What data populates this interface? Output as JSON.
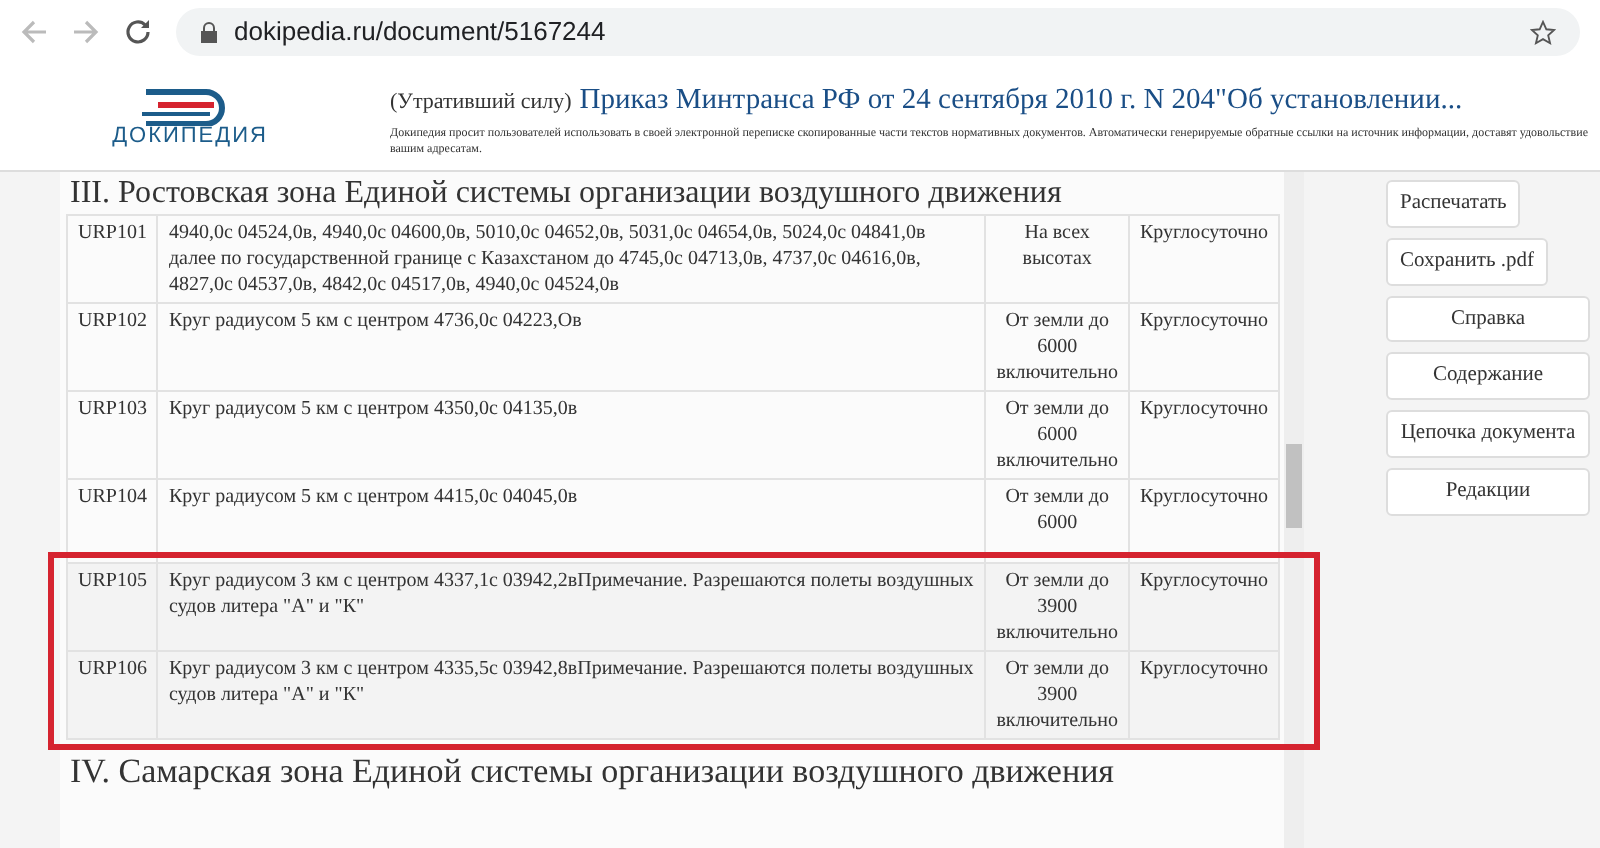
{
  "browser": {
    "url": "dokipedia.ru/document/5167244"
  },
  "header": {
    "logo": "ДОКИПЕДИЯ",
    "status": "(Утративший силу)",
    "title": "Приказ Минтранса РФ от 24 сентября 2010 г. N 204\"Об установлении...",
    "notice": "Докипедия просит пользователей использовать в своей электронной переписке скопированные части текстов нормативных документов. Автоматически генерируемые обратные ссылки на источник информации, доставят удовольствие вашим адресатам."
  },
  "section_heading": "III. Ростовская зона Единой системы организации воздушного движения",
  "row_groups": [
    {
      "highlighted": false,
      "rows": [
        {
          "code": "URP101",
          "description": "4940,0с 04524,0в, 4940,0с 04600,0в, 5010,0с 04652,0в, 5031,0с 04654,0в, 5024,0с 04841,0в далее по государственной границе с Казахстаном до 4745,0с 04713,0в, 4737,0с 04616,0в, 4827,0с 04537,0в, 4842,0с 04517,0в, 4940,0с 04524,0в",
          "altitude": "На всех высотах",
          "time": "Круглосуточно"
        },
        {
          "code": "URP102",
          "description": "Круг радиусом 5 км с центром 4736,0с 04223,Ов",
          "altitude": "От земли до 6000 включительно",
          "time": "Круглосуточно"
        },
        {
          "code": "URP103",
          "description": "Круг радиусом 5 км с центром 4350,0с 04135,0в",
          "altitude": "От земли до 6000 включительно",
          "time": "Круглосуточно"
        },
        {
          "code": "URP104",
          "description": "Круг радиусом 5 км с центром 4415,0с 04045,0в",
          "altitude": "От земли до 6000",
          "time": "Круглосуточно"
        }
      ]
    },
    {
      "highlighted": true,
      "rows": [
        {
          "code": "URP105",
          "description": "Круг радиусом 3 км с центром 4337,1с 03942,2вПримечание. Разрешаются полеты воздушных судов литера \"А\" и \"К\"",
          "altitude": "От земли до 3900 включительно",
          "time": "Круглосуточно"
        },
        {
          "code": "URP106",
          "description": "Круг радиусом 3 км с центром 4335,5с 03942,8вПримечание. Разрешаются полеты воздушных судов литера \"А\" и \"К\"",
          "altitude": "От земли до 3900 включительно",
          "time": "Круглосуточно"
        }
      ]
    }
  ],
  "next_heading": "IV. Самарская зона Единой системы организации воздушного движения",
  "sidebar_buttons": [
    {
      "label": "Распечатать",
      "kind": "small"
    },
    {
      "label": "Сохранить .pdf",
      "kind": "small"
    },
    {
      "label": "Справка",
      "kind": "wide"
    },
    {
      "label": "Содержание",
      "kind": "wide"
    },
    {
      "label": "Цепочка документа",
      "kind": "wide"
    },
    {
      "label": "Редакции",
      "kind": "wide"
    }
  ]
}
